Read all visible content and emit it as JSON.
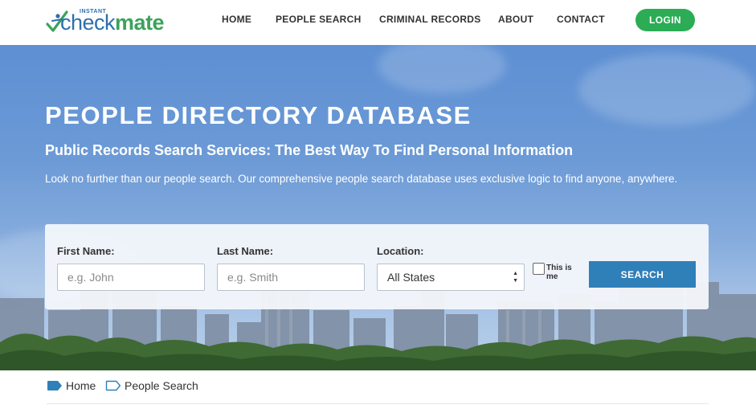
{
  "header": {
    "logo": {
      "small": "INSTANT",
      "check": "check",
      "mate": "mate"
    },
    "nav": {
      "home": "HOME",
      "people_search": "PEOPLE SEARCH",
      "criminal_records": "CRIMINAL RECORDS",
      "about": "ABOUT",
      "contact": "CONTACT"
    },
    "login_label": "LOGIN"
  },
  "hero": {
    "title": "PEOPLE DIRECTORY DATABASE",
    "subtitle": "Public Records Search Services: The Best Way To Find Personal Information",
    "description": "Look no further than our people search. Our comprehensive people search database uses exclusive logic to find anyone, anywhere."
  },
  "search_form": {
    "first_name": {
      "label": "First Name:",
      "placeholder": "e.g. John"
    },
    "last_name": {
      "label": "Last Name:",
      "placeholder": "e.g. Smith"
    },
    "location": {
      "label": "Location:",
      "selected": "All States"
    },
    "this_is_me": {
      "label": "This is me",
      "checked": false
    },
    "search_label": "SEARCH"
  },
  "breadcrumb": {
    "items": [
      {
        "label": "Home"
      },
      {
        "label": "People Search"
      }
    ]
  },
  "colors": {
    "brand_blue": "#2e6fae",
    "brand_green": "#3aa35a",
    "login_green": "#2bac55",
    "search_blue": "#2f7fb9"
  },
  "icons": {
    "logo_mark": "checkmark-figure-icon",
    "breadcrumb_home": "tag-filled-icon",
    "breadcrumb_people": "tag-outline-icon",
    "select": "up-down-arrows-icon"
  }
}
